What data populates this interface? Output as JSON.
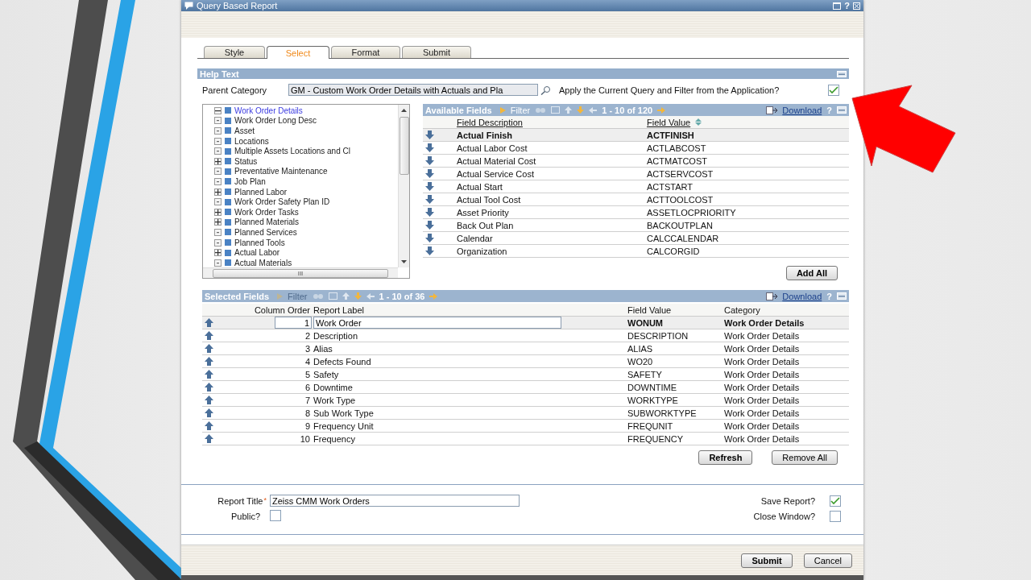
{
  "window": {
    "title": "Query Based Report",
    "help": "?"
  },
  "tabs": [
    {
      "label": "Style",
      "selected": false
    },
    {
      "label": "Select",
      "selected": true
    },
    {
      "label": "Format",
      "selected": false
    },
    {
      "label": "Submit",
      "selected": false
    }
  ],
  "help_section": {
    "title": "Help Text"
  },
  "parent_category": {
    "label": "Parent Category",
    "value": "GM - Custom Work Order Details with Actuals and Pla"
  },
  "apply_query": {
    "label": "Apply the Current Query and Filter from the Application?",
    "checked": true
  },
  "tree": {
    "label": "Work Order Details",
    "kind": "folder",
    "expanded": true,
    "selected": true,
    "children": [
      {
        "label": "Work Order Long Desc",
        "kind": "leaf",
        "selected": false
      },
      {
        "label": "Asset",
        "kind": "leaf",
        "selected": false
      },
      {
        "label": "Locations",
        "kind": "leaf",
        "selected": false
      },
      {
        "label": "Multiple Assets Locations and Cl",
        "kind": "leaf",
        "selected": false
      },
      {
        "label": "Status",
        "kind": "folder",
        "expanded": false,
        "selected": false
      },
      {
        "label": "Preventative Maintenance",
        "kind": "leaf",
        "selected": false
      },
      {
        "label": "Job Plan",
        "kind": "leaf",
        "selected": false
      },
      {
        "label": "Planned Labor",
        "kind": "folder",
        "expanded": false,
        "selected": false
      },
      {
        "label": "Work Order Safety Plan ID",
        "kind": "leaf",
        "selected": false
      },
      {
        "label": "Work Order Tasks",
        "kind": "folder",
        "expanded": false,
        "selected": false
      },
      {
        "label": "Planned Materials",
        "kind": "folder",
        "expanded": false,
        "selected": false
      },
      {
        "label": "Planned Services",
        "kind": "leaf",
        "selected": false
      },
      {
        "label": "Planned Tools",
        "kind": "leaf",
        "selected": false
      },
      {
        "label": "Actual Labor",
        "kind": "folder",
        "expanded": false,
        "selected": false
      },
      {
        "label": "Actual Materials",
        "kind": "leaf",
        "selected": false
      }
    ],
    "scrollbar_grip": "III"
  },
  "available_fields": {
    "title": "Available Fields",
    "toolbar": {
      "filter": {
        "label": "Filter",
        "disabled": false
      },
      "pager": "1 - 10 of 120",
      "download": "Download",
      "help": "?"
    },
    "columns": [
      "Field Description",
      "Field Value"
    ],
    "rows": [
      {
        "description": "Actual Finish",
        "value": "ACTFINISH",
        "selected": true
      },
      {
        "description": "Actual Labor Cost",
        "value": "ACTLABCOST",
        "selected": false
      },
      {
        "description": "Actual Material Cost",
        "value": "ACTMATCOST",
        "selected": false
      },
      {
        "description": "Actual Service Cost",
        "value": "ACTSERVCOST",
        "selected": false
      },
      {
        "description": "Actual Start",
        "value": "ACTSTART",
        "selected": false
      },
      {
        "description": "Actual Tool Cost",
        "value": "ACTTOOLCOST",
        "selected": false
      },
      {
        "description": "Asset Priority",
        "value": "ASSETLOCPRIORITY",
        "selected": false
      },
      {
        "description": "Back Out Plan",
        "value": "BACKOUTPLAN",
        "selected": false
      },
      {
        "description": "Calendar",
        "value": "CALCCALENDAR",
        "selected": false
      },
      {
        "description": "Organization",
        "value": "CALCORGID",
        "selected": false
      }
    ],
    "add_all": "Add All"
  },
  "selected_fields": {
    "title": "Selected Fields",
    "toolbar": {
      "filter": {
        "label": "Filter",
        "disabled": true
      },
      "pager": "1 - 10 of 36",
      "download": "Download",
      "help": "?"
    },
    "columns": [
      "Column Order",
      "Report Label",
      "Field Value",
      "Category"
    ],
    "rows": [
      {
        "order": "1",
        "label": "Work Order",
        "value": "WONUM",
        "category": "Work Order Details",
        "selected": true
      },
      {
        "order": "2",
        "label": "Description",
        "value": "DESCRIPTION",
        "category": "Work Order Details",
        "selected": false
      },
      {
        "order": "3",
        "label": "Alias",
        "value": "ALIAS",
        "category": "Work Order Details",
        "selected": false
      },
      {
        "order": "4",
        "label": "Defects Found",
        "value": "WO20",
        "category": "Work Order Details",
        "selected": false
      },
      {
        "order": "5",
        "label": "Safety",
        "value": "SAFETY",
        "category": "Work Order Details",
        "selected": false
      },
      {
        "order": "6",
        "label": "Downtime",
        "value": "DOWNTIME",
        "category": "Work Order Details",
        "selected": false
      },
      {
        "order": "7",
        "label": "Work Type",
        "value": "WORKTYPE",
        "category": "Work Order Details",
        "selected": false
      },
      {
        "order": "8",
        "label": "Sub Work Type",
        "value": "SUBWORKTYPE",
        "category": "Work Order Details",
        "selected": false
      },
      {
        "order": "9",
        "label": "Frequency Unit",
        "value": "FREQUNIT",
        "category": "Work Order Details",
        "selected": false
      },
      {
        "order": "10",
        "label": "Frequency",
        "value": "FREQUENCY",
        "category": "Work Order Details",
        "selected": false
      }
    ],
    "buttons": [
      "Refresh",
      "Remove All"
    ]
  },
  "report": {
    "title_label": "Report Title",
    "required_mark": "*",
    "title_value": "Zeiss CMM Work Orders",
    "public": {
      "label": "Public?",
      "checked": false
    },
    "save_report": {
      "label": "Save Report?",
      "checked": true
    },
    "close_window": {
      "label": "Close Window?",
      "checked": false
    }
  },
  "footer_buttons": [
    "Submit",
    "Cancel"
  ]
}
